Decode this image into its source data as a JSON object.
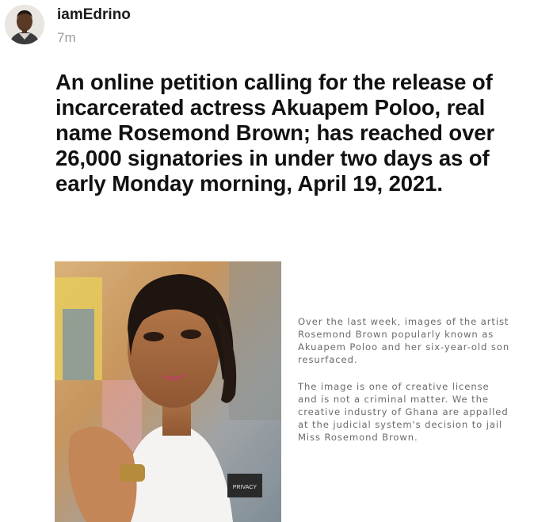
{
  "post": {
    "username": "iamEdrino",
    "timestamp": "7m",
    "text": "An online petition calling for the release of incarcerated actress Akuapem Poloo, real name Rosemond Brown; has reached over 26,000 signatories in under two days as of early Monday morning, April 19, 2021."
  },
  "image": {
    "caption_paragraphs": [
      "Over the last week, images of the artist Rosemond Brown popularly known as Akuapem Poloo and her six-year-old son resurfaced.",
      "The image is one of creative license and is not a criminal matter. We the creative industry of Ghana are appalled at the judicial system's decision to jail Miss Rosemond Brown."
    ],
    "shirt_print": "PRIVACY"
  }
}
